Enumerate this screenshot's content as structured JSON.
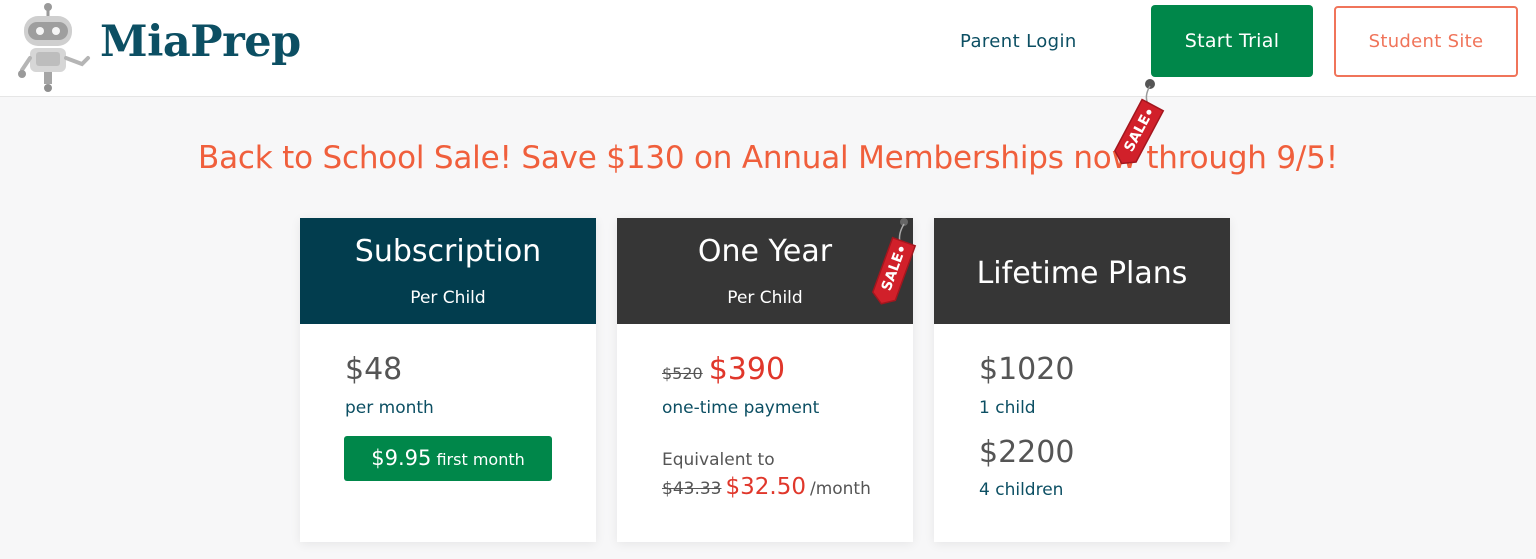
{
  "header": {
    "brand": "MiaPrep",
    "nav": {
      "parent_login": "Parent Login",
      "start_trial": "Start Trial",
      "student_site": "Student Site"
    }
  },
  "sale_banner": "Back to School Sale! Save $130 on Annual Memberships now through 9/5!",
  "sale_tag_label": "SALE",
  "plans": [
    {
      "title": "Subscription",
      "subtitle": "Per Child",
      "price": "$48",
      "note": "per month",
      "promo_price": "$9.95",
      "promo_label": "first month"
    },
    {
      "title": "One Year",
      "subtitle": "Per Child",
      "old_price": "$520",
      "price": "$390",
      "note": "one-time payment",
      "equiv_label": "Equivalent to",
      "equiv_old": "$43.33",
      "equiv_price": "$32.50",
      "equiv_unit": "/month"
    },
    {
      "title": "Lifetime Plans",
      "options": [
        {
          "price": "$1020",
          "note": "1 child"
        },
        {
          "price": "$2200",
          "note": "4 children"
        }
      ]
    }
  ],
  "colors": {
    "brand_teal": "#0c4f63",
    "green": "#00874a",
    "coral": "#f0745a",
    "sale_red": "#e0372b",
    "banner_orange": "#f05f3c",
    "card_head_dark": "#363636",
    "card_head_navy": "#023d4e"
  }
}
